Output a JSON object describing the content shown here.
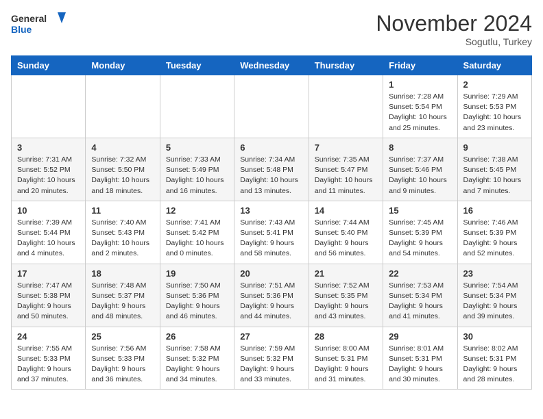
{
  "header": {
    "logo_general": "General",
    "logo_blue": "Blue",
    "month_title": "November 2024",
    "location": "Sogutlu, Turkey"
  },
  "days_of_week": [
    "Sunday",
    "Monday",
    "Tuesday",
    "Wednesday",
    "Thursday",
    "Friday",
    "Saturday"
  ],
  "weeks": [
    [
      {
        "day": "",
        "info": ""
      },
      {
        "day": "",
        "info": ""
      },
      {
        "day": "",
        "info": ""
      },
      {
        "day": "",
        "info": ""
      },
      {
        "day": "",
        "info": ""
      },
      {
        "day": "1",
        "info": "Sunrise: 7:28 AM\nSunset: 5:54 PM\nDaylight: 10 hours\nand 25 minutes."
      },
      {
        "day": "2",
        "info": "Sunrise: 7:29 AM\nSunset: 5:53 PM\nDaylight: 10 hours\nand 23 minutes."
      }
    ],
    [
      {
        "day": "3",
        "info": "Sunrise: 7:31 AM\nSunset: 5:52 PM\nDaylight: 10 hours\nand 20 minutes."
      },
      {
        "day": "4",
        "info": "Sunrise: 7:32 AM\nSunset: 5:50 PM\nDaylight: 10 hours\nand 18 minutes."
      },
      {
        "day": "5",
        "info": "Sunrise: 7:33 AM\nSunset: 5:49 PM\nDaylight: 10 hours\nand 16 minutes."
      },
      {
        "day": "6",
        "info": "Sunrise: 7:34 AM\nSunset: 5:48 PM\nDaylight: 10 hours\nand 13 minutes."
      },
      {
        "day": "7",
        "info": "Sunrise: 7:35 AM\nSunset: 5:47 PM\nDaylight: 10 hours\nand 11 minutes."
      },
      {
        "day": "8",
        "info": "Sunrise: 7:37 AM\nSunset: 5:46 PM\nDaylight: 10 hours\nand 9 minutes."
      },
      {
        "day": "9",
        "info": "Sunrise: 7:38 AM\nSunset: 5:45 PM\nDaylight: 10 hours\nand 7 minutes."
      }
    ],
    [
      {
        "day": "10",
        "info": "Sunrise: 7:39 AM\nSunset: 5:44 PM\nDaylight: 10 hours\nand 4 minutes."
      },
      {
        "day": "11",
        "info": "Sunrise: 7:40 AM\nSunset: 5:43 PM\nDaylight: 10 hours\nand 2 minutes."
      },
      {
        "day": "12",
        "info": "Sunrise: 7:41 AM\nSunset: 5:42 PM\nDaylight: 10 hours\nand 0 minutes."
      },
      {
        "day": "13",
        "info": "Sunrise: 7:43 AM\nSunset: 5:41 PM\nDaylight: 9 hours\nand 58 minutes."
      },
      {
        "day": "14",
        "info": "Sunrise: 7:44 AM\nSunset: 5:40 PM\nDaylight: 9 hours\nand 56 minutes."
      },
      {
        "day": "15",
        "info": "Sunrise: 7:45 AM\nSunset: 5:39 PM\nDaylight: 9 hours\nand 54 minutes."
      },
      {
        "day": "16",
        "info": "Sunrise: 7:46 AM\nSunset: 5:39 PM\nDaylight: 9 hours\nand 52 minutes."
      }
    ],
    [
      {
        "day": "17",
        "info": "Sunrise: 7:47 AM\nSunset: 5:38 PM\nDaylight: 9 hours\nand 50 minutes."
      },
      {
        "day": "18",
        "info": "Sunrise: 7:48 AM\nSunset: 5:37 PM\nDaylight: 9 hours\nand 48 minutes."
      },
      {
        "day": "19",
        "info": "Sunrise: 7:50 AM\nSunset: 5:36 PM\nDaylight: 9 hours\nand 46 minutes."
      },
      {
        "day": "20",
        "info": "Sunrise: 7:51 AM\nSunset: 5:36 PM\nDaylight: 9 hours\nand 44 minutes."
      },
      {
        "day": "21",
        "info": "Sunrise: 7:52 AM\nSunset: 5:35 PM\nDaylight: 9 hours\nand 43 minutes."
      },
      {
        "day": "22",
        "info": "Sunrise: 7:53 AM\nSunset: 5:34 PM\nDaylight: 9 hours\nand 41 minutes."
      },
      {
        "day": "23",
        "info": "Sunrise: 7:54 AM\nSunset: 5:34 PM\nDaylight: 9 hours\nand 39 minutes."
      }
    ],
    [
      {
        "day": "24",
        "info": "Sunrise: 7:55 AM\nSunset: 5:33 PM\nDaylight: 9 hours\nand 37 minutes."
      },
      {
        "day": "25",
        "info": "Sunrise: 7:56 AM\nSunset: 5:33 PM\nDaylight: 9 hours\nand 36 minutes."
      },
      {
        "day": "26",
        "info": "Sunrise: 7:58 AM\nSunset: 5:32 PM\nDaylight: 9 hours\nand 34 minutes."
      },
      {
        "day": "27",
        "info": "Sunrise: 7:59 AM\nSunset: 5:32 PM\nDaylight: 9 hours\nand 33 minutes."
      },
      {
        "day": "28",
        "info": "Sunrise: 8:00 AM\nSunset: 5:31 PM\nDaylight: 9 hours\nand 31 minutes."
      },
      {
        "day": "29",
        "info": "Sunrise: 8:01 AM\nSunset: 5:31 PM\nDaylight: 9 hours\nand 30 minutes."
      },
      {
        "day": "30",
        "info": "Sunrise: 8:02 AM\nSunset: 5:31 PM\nDaylight: 9 hours\nand 28 minutes."
      }
    ]
  ]
}
